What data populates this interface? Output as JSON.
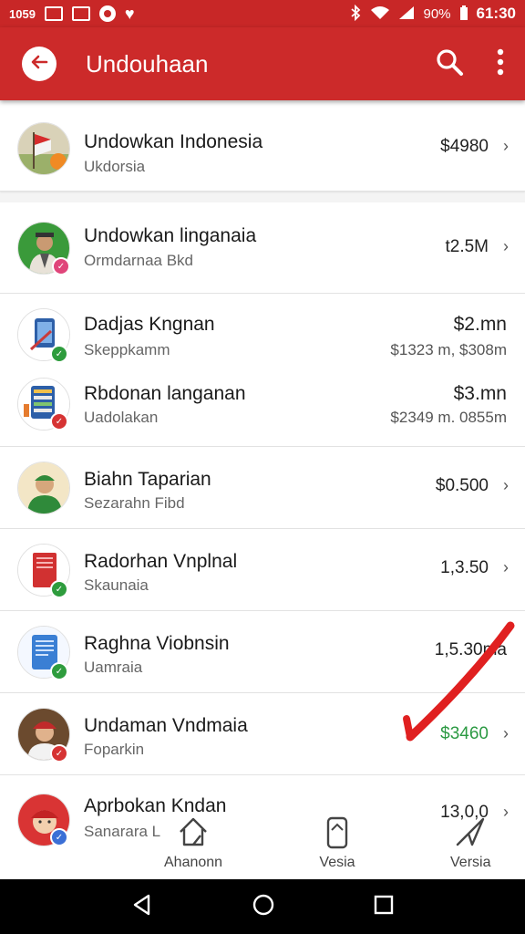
{
  "status_bar": {
    "left_time": "1059",
    "battery": "90%",
    "clock": "61:30"
  },
  "app_bar": {
    "title": "Undouhaan",
    "back_icon": "back-arrow-icon",
    "search_icon": "search-icon",
    "menu_icon": "more-vert-icon"
  },
  "list": {
    "items": [
      {
        "title": "Undowkan Indonesia",
        "subtitle": "Ukdorsia",
        "amount": "$4980"
      },
      {
        "title": "Undowkan linganaia",
        "subtitle": "Ormdarnaa Bkd",
        "amount": "t2.5M"
      },
      {
        "title": "Dadjas Kngnan",
        "subtitle": "Skeppkamm",
        "amount": "$2.mn",
        "secondary": "$1323 m, $308m"
      },
      {
        "title": "Rbdonan langanan",
        "subtitle": "Uadolakan",
        "amount": "$3.mn",
        "secondary": "$2349 m. 0855m"
      },
      {
        "title": "Biahn Taparian",
        "subtitle": "Sezarahn Fibd",
        "amount": "$0.500"
      },
      {
        "title": "Radorhan Vnplnal",
        "subtitle": "Skaunaia",
        "amount": "1,3.50"
      },
      {
        "title": "Raghna Viobnsin",
        "subtitle": "Uamraia",
        "amount": "1,5.30ma"
      },
      {
        "title": "Undaman Vndmaia",
        "subtitle": "Foparkin",
        "amount": "$3460"
      },
      {
        "title": "Aprbokan Kndan",
        "subtitle": "Sanarara L",
        "amount": "13,0,0"
      }
    ]
  },
  "bottom_nav": {
    "items": [
      {
        "label": "Ahanonn",
        "icon": "home-icon"
      },
      {
        "label": "Vesia",
        "icon": "phone-icon"
      },
      {
        "label": "Versia",
        "icon": "send-icon"
      }
    ]
  },
  "system_nav": {
    "back_icon": "system-back-icon",
    "home_icon": "system-home-icon",
    "recents_icon": "system-recents-icon"
  },
  "colors": {
    "primary": "#cc2a2a",
    "positive": "#2c9a43",
    "badge_green": "#2e9c3d",
    "badge_red": "#d63333"
  }
}
